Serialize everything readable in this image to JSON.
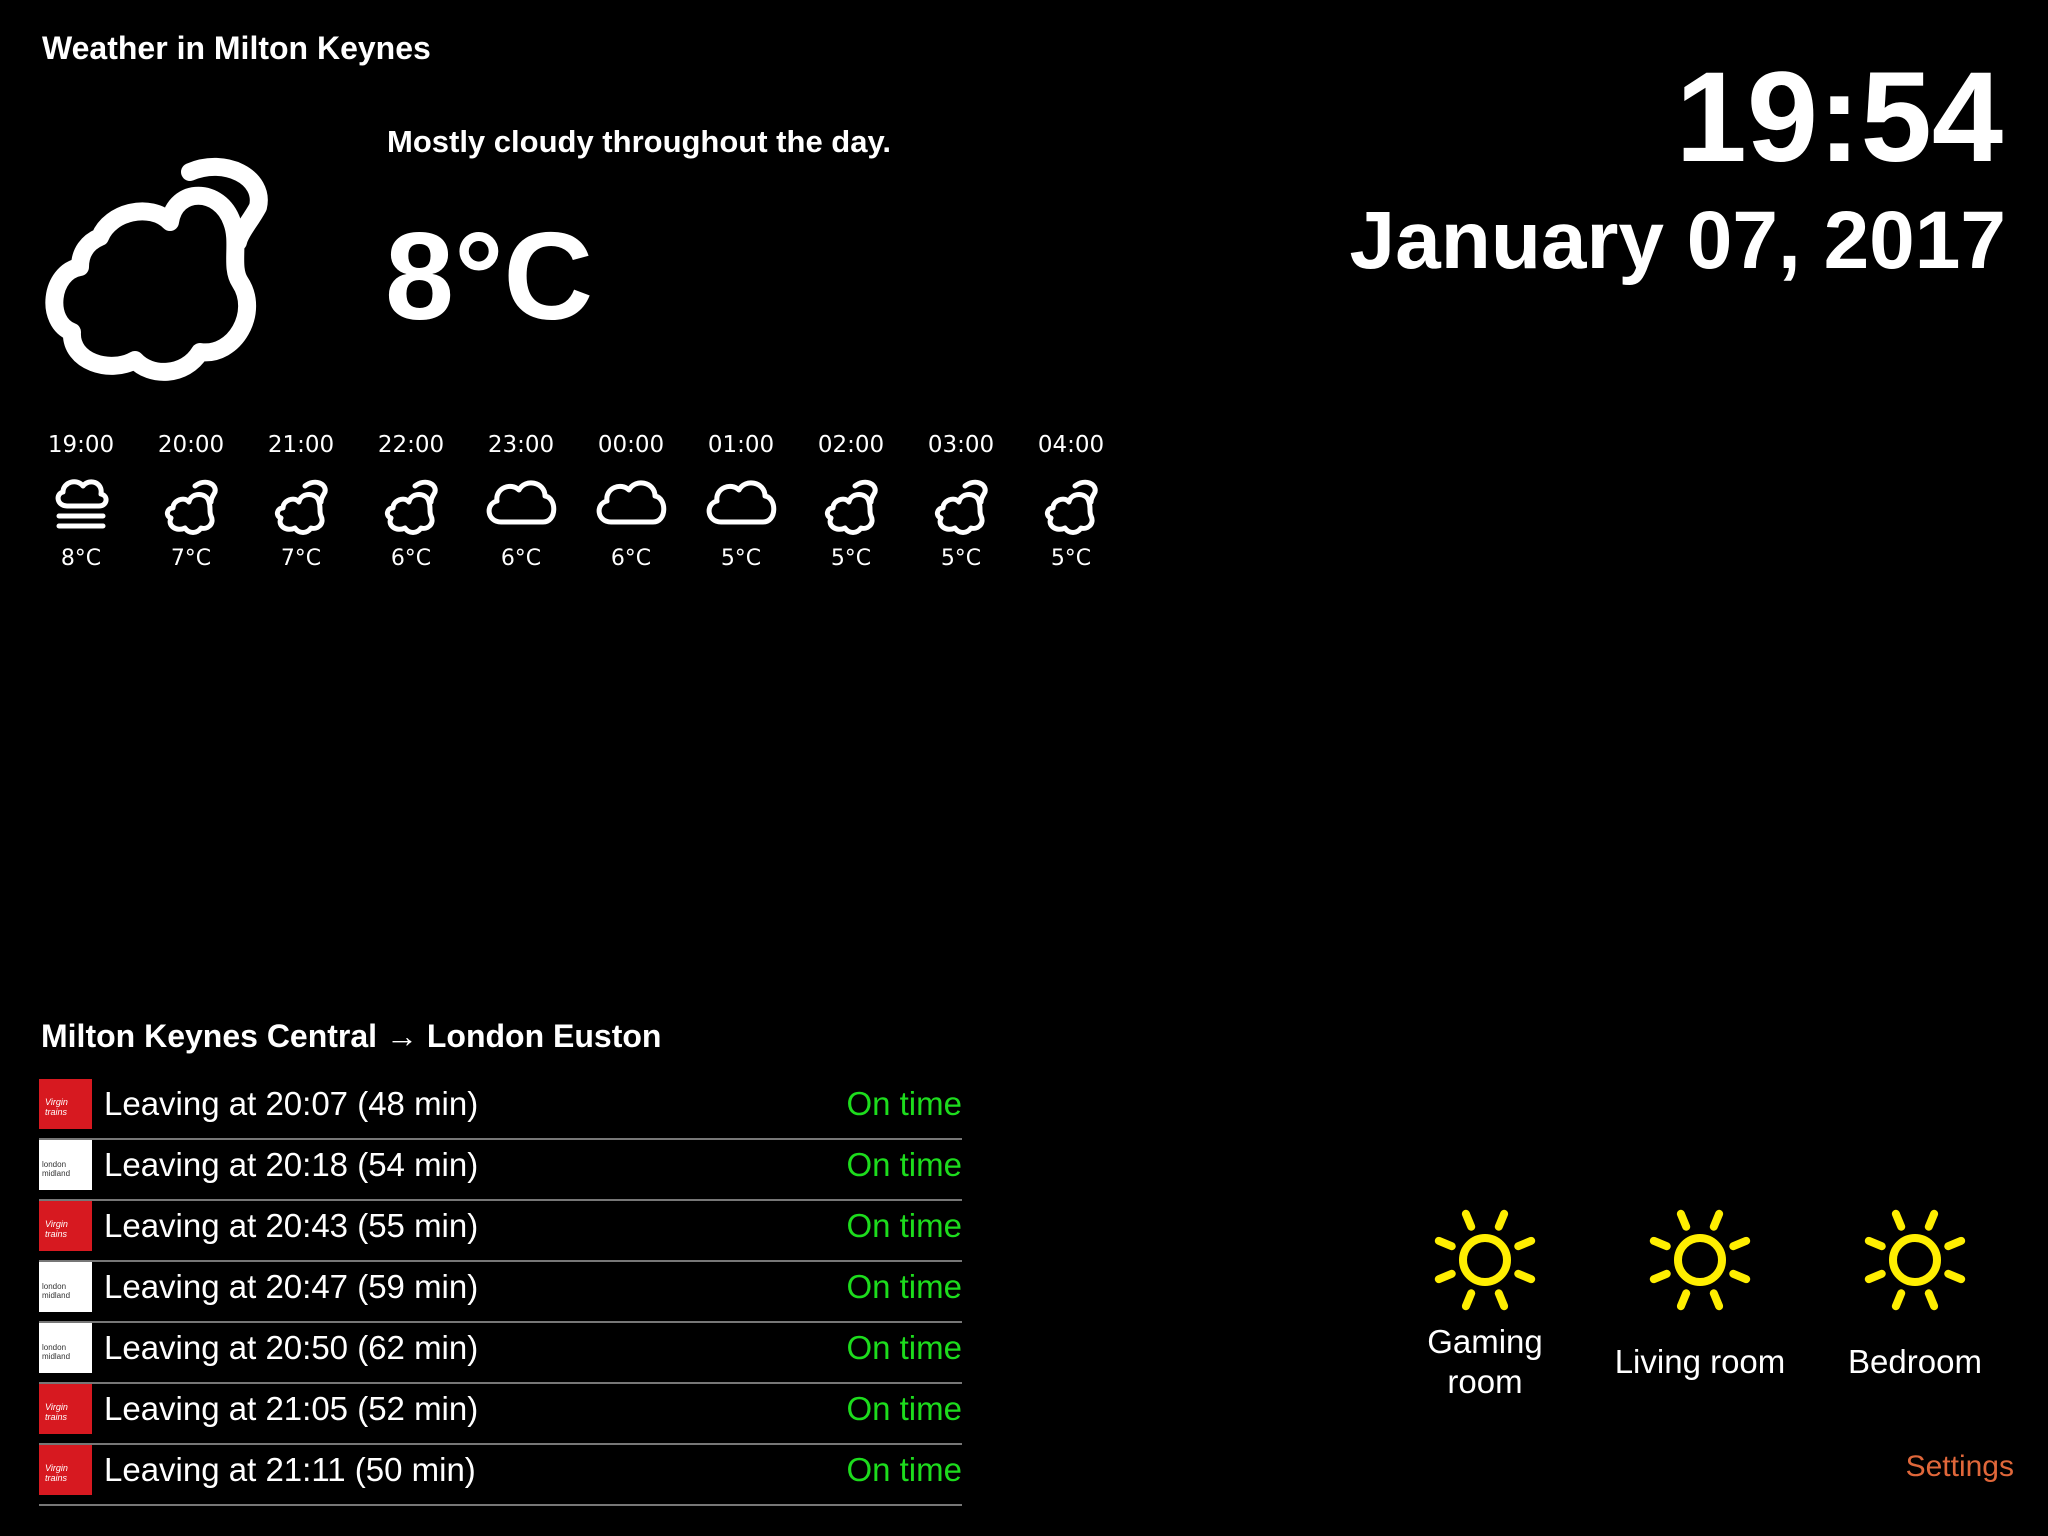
{
  "weather": {
    "title": "Weather in Milton Keynes",
    "summary": "Mostly cloudy throughout the day.",
    "temperature": "8°C",
    "icon": "partly-cloudy-icon"
  },
  "clock": {
    "time": "19:54",
    "date": "January 07, 2017"
  },
  "hourly": [
    {
      "time": "19:00",
      "temp": "8°C",
      "icon": "fog-icon"
    },
    {
      "time": "20:00",
      "temp": "7°C",
      "icon": "partly-cloudy-icon"
    },
    {
      "time": "21:00",
      "temp": "7°C",
      "icon": "partly-cloudy-icon"
    },
    {
      "time": "22:00",
      "temp": "6°C",
      "icon": "partly-cloudy-icon"
    },
    {
      "time": "23:00",
      "temp": "6°C",
      "icon": "cloud-icon"
    },
    {
      "time": "00:00",
      "temp": "6°C",
      "icon": "cloud-icon"
    },
    {
      "time": "01:00",
      "temp": "5°C",
      "icon": "cloud-icon"
    },
    {
      "time": "02:00",
      "temp": "5°C",
      "icon": "partly-cloudy-icon"
    },
    {
      "time": "03:00",
      "temp": "5°C",
      "icon": "partly-cloudy-icon"
    },
    {
      "time": "04:00",
      "temp": "5°C",
      "icon": "partly-cloudy-icon"
    }
  ],
  "trains": {
    "route": "Milton Keynes Central → London Euston",
    "departures": [
      {
        "operator": "virgin",
        "logo_text": "Virgin trains",
        "text": "Leaving at 20:07 (48 min)",
        "status": "On time"
      },
      {
        "operator": "em",
        "logo_text": "london midland",
        "text": "Leaving at 20:18 (54 min)",
        "status": "On time"
      },
      {
        "operator": "virgin",
        "logo_text": "Virgin trains",
        "text": "Leaving at 20:43 (55 min)",
        "status": "On time"
      },
      {
        "operator": "em",
        "logo_text": "london midland",
        "text": "Leaving at 20:47 (59 min)",
        "status": "On time"
      },
      {
        "operator": "em",
        "logo_text": "london midland",
        "text": "Leaving at 20:50 (62 min)",
        "status": "On time"
      },
      {
        "operator": "virgin",
        "logo_text": "Virgin trains",
        "text": "Leaving at 21:05 (52 min)",
        "status": "On time"
      },
      {
        "operator": "virgin",
        "logo_text": "Virgin trains",
        "text": "Leaving at 21:11 (50 min)",
        "status": "On time"
      }
    ],
    "status_color": "#1ddc1d"
  },
  "rooms": [
    {
      "label": "Gaming room",
      "icon": "light-bulb-sun-icon",
      "color": "#ffee00"
    },
    {
      "label": "Living room",
      "icon": "light-bulb-sun-icon",
      "color": "#ffee00"
    },
    {
      "label": "Bedroom",
      "icon": "light-bulb-sun-icon",
      "color": "#ffee00"
    }
  ],
  "settings_label": "Settings",
  "settings_color": "#e0673a"
}
